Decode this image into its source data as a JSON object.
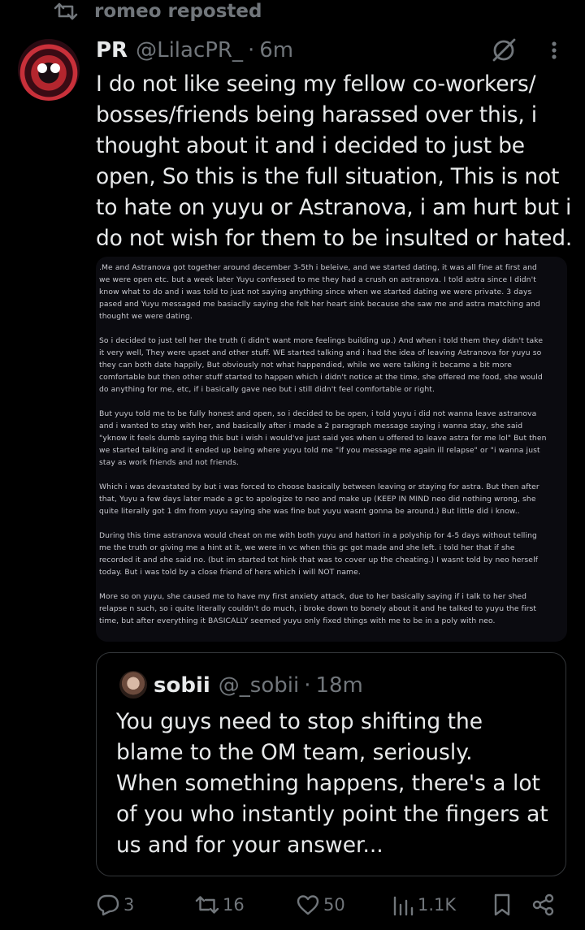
{
  "repost": {
    "text": "romeo reposted"
  },
  "tweet": {
    "display_name": "PR",
    "handle": "@LilacPR_",
    "separator": "·",
    "time": "6m",
    "text": "I do not like seeing my fellow co-workers/ bosses/friends being harassed over this, i thought about it and i decided to just be open, So this is the full situation, This is not to hate on yuyu or Astranova, i am hurt but i do not wish for them to be insulted or hated.",
    "media_paragraphs": [
      ".Me and Astranova got together around december 3-5th i beleive, and we started dating, it was all fine at first and we were open etc. but a week later Yuyu confessed to me they had a crush on astranova. I told astra since I didn't know what to do and i was told to just not saying anything since when we started dating we were private. 3 days pased and Yuyu messaged me basiaclly saying she felt her heart sink because she saw me and astra matching and thought we were dating.",
      "So i decided to just tell her the truth (i didn't want more feelings building up.) And when i told them they didn't take it very well, They were upset and other stuff. WE started talking and i had the idea of leaving Astranova for yuyu so they can both date happily, But obviously not what happendied, while we were talking it became a bit more comfortable but then other stuff started to happen which i didn't notice at the time, she offered me food, she would do anything for me, etc, if i basically gave neo but i still didn't feel comfortable or right.",
      "But yuyu told me to be fully honest and open, so i decided to be open, i told yuyu i did not wanna leave astranova and i wanted to stay with her, and basically after i made a 2 paragraph message saying i wanna stay, she said \"yknow it feels dumb saying this but i wish i would've just said yes when u offered to leave astra for me lol\" But then we started talking and it ended up being where yuyu told me \"if you message me again ill relapse\" or \"i wanna just stay as work friends and not friends.",
      "Which i was devastated by but i was forced to choose basically between leaving or staying for astra. But then after that, Yuyu a few days later made a gc to apologize to neo and make up (KEEP IN MIND neo did nothing wrong, she quite literally got 1 dm from yuyu saying she was fine but yuyu wasnt gonna be around.) But little did i know..",
      "During this time astranova would cheat on me with both yuyu and hattori in a polyship for 4-5 days without telling me the truth or giving me a hint at it, we were in vc when this gc got made and she left. i told her that if she recorded it and she said no. (but im started tot hink that was to cover up the cheating.) I wasnt told by neo herself today. But i was told by a close friend of hers which i will NOT name.",
      "More so on yuyu, she caused me to have my first anxiety attack, due to her basically saying if i talk to her shed relapse n such, so i quite literally couldn't do much, i broke down to bonely about it and he talked to yuyu the first time, but after everything it BASICALLY seemed yuyu only fixed things with me to be in a poly with neo."
    ]
  },
  "quote": {
    "display_name": "sobii",
    "handle": "@_sobii",
    "separator": "·",
    "time": "18m",
    "text_line1": "You guys need to stop shifting the blame to the OM team, seriously.",
    "text_line2": "When something happens, there's a lot of you who instantly point the fingers at us and for your answer..."
  },
  "actions": {
    "replies": "3",
    "reposts": "16",
    "likes": "50",
    "views": "1.1K"
  },
  "icons": {
    "repost": "repost-icon",
    "grok": "grok-icon",
    "more": "more-dots-icon",
    "reply": "reply-icon",
    "like": "heart-icon",
    "views": "views-icon",
    "bookmark": "bookmark-icon",
    "share": "share-icon"
  },
  "colors": {
    "background": "#000000",
    "text": "#e7e9ea",
    "muted": "#71767b",
    "border": "#333639"
  }
}
